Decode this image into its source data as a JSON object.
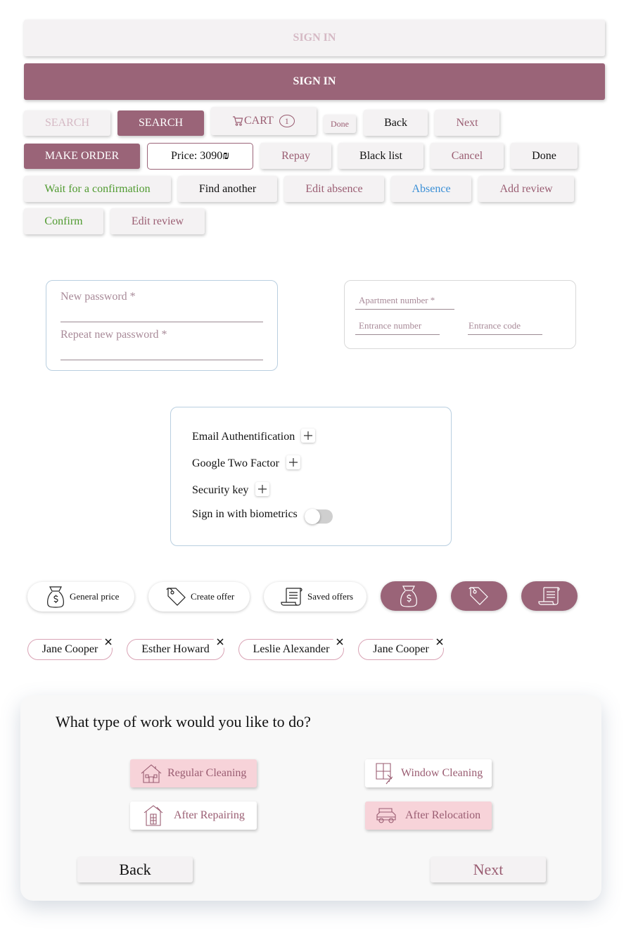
{
  "buttons": {
    "sign_in_disabled": "SIGN IN",
    "sign_in": "SIGN IN",
    "search_disabled": "SEARCH",
    "search": "SEARCH",
    "cart": "CART",
    "cart_count": "1",
    "done_small": "Done",
    "back": "Back",
    "next": "Next",
    "make_order": "MAKE ORDER",
    "price": "Price: 3090",
    "currency_symbol": "₪",
    "repay": "Repay",
    "black_list": "Black list",
    "cancel": "Cancel",
    "done": "Done",
    "wait_confirmation": "Wait for a confirmation",
    "find_another": "Find another",
    "edit_absence": "Edit absence",
    "absence": "Absence",
    "add_review": "Add review",
    "confirm": "Confirm",
    "edit_review": "Edit review"
  },
  "password_form": {
    "new_password": "New password *",
    "repeat_password": "Repeat new password *"
  },
  "address_form": {
    "apartment_number": "Apartment number *",
    "entrance_number": "Entrance number",
    "entrance_code": "Entrance code"
  },
  "security": {
    "email_auth": "Email Authentification",
    "google_two_factor": "Google Two Factor",
    "security_key": "Security key",
    "biometrics": "Sign in with biometrics",
    "biometrics_enabled": false
  },
  "pills": {
    "general_price": "General price",
    "create_offer": "Create offer",
    "saved_offers": "Saved offers"
  },
  "chips": [
    "Jane Cooper",
    "Esther Howard",
    "Leslie Alexander",
    "Jane Cooper"
  ],
  "work_type": {
    "question": "What type of work would you like to do?",
    "options": [
      {
        "label": "Regular Cleaning",
        "icon": "house-cleaning-icon",
        "selected": true
      },
      {
        "label": "Window Cleaning",
        "icon": "window-cleaning-icon",
        "selected": false
      },
      {
        "label": "After Repairing",
        "icon": "repair-icon",
        "selected": false
      },
      {
        "label": "After Relocation",
        "icon": "relocation-car-icon",
        "selected": true
      }
    ],
    "back": "Back",
    "next": "Next"
  },
  "colors": {
    "primary": "#9a6478",
    "plum_text": "#9a5d72",
    "pale_text": "#d5b9c4",
    "green_text": "#4f9a2f",
    "blue_text": "#3a8fd6",
    "selected_option_bg": "#f7d3d9"
  }
}
